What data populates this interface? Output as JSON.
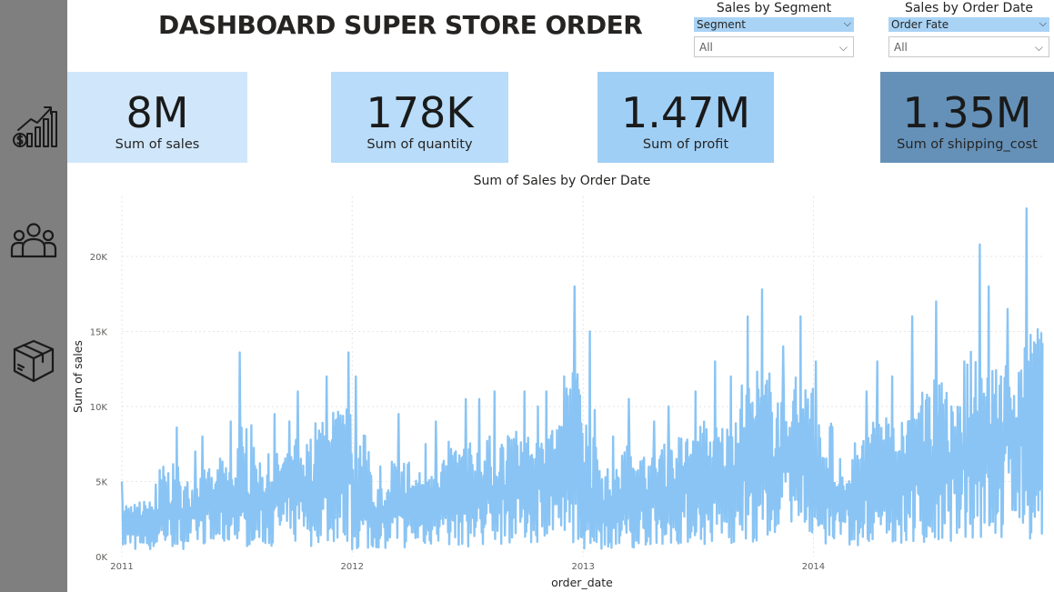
{
  "dashboard": {
    "title": "DASHBOARD SUPER STORE ORDER"
  },
  "sidebar": {
    "items": [
      {
        "icon": "sales-growth-icon"
      },
      {
        "icon": "customers-icon"
      },
      {
        "icon": "product-box-icon"
      }
    ]
  },
  "slicers": [
    {
      "title": "Sales by Segment",
      "field": "Segment",
      "selected": "All"
    },
    {
      "title": "Sales by Order Date",
      "field": "Order Fate",
      "selected": "All"
    }
  ],
  "kpis": [
    {
      "value": "8M",
      "label": "Sum of sales",
      "color": "#d0e7fb"
    },
    {
      "value": "178K",
      "label": "Sum of quantity",
      "color": "#b8dcf9"
    },
    {
      "value": "1.47M",
      "label": "Sum of profit",
      "color": "#a0cff5"
    },
    {
      "value": "1.35M",
      "label": "Sum of shipping_cost",
      "color": "#6591b8"
    }
  ],
  "colors": {
    "sidebar": "#7f7f7f",
    "series": "#89c4f4",
    "slicer_header": "#a9d3f5"
  },
  "chart_data": {
    "type": "line",
    "title": "Sum of Sales by Order Date",
    "xlabel": "order_date",
    "ylabel": "Sum of sales",
    "x_ticks": [
      "2011",
      "2012",
      "2013",
      "2014"
    ],
    "y_ticks": [
      "0K",
      "5K",
      "10K",
      "15K",
      "20K"
    ],
    "xlim": [
      "2011-01-01",
      "2014-12-31"
    ],
    "ylim": [
      0,
      24000
    ],
    "grid": true,
    "series": [
      {
        "x": [
          "2011-01",
          "2011-02",
          "2011-03",
          "2011-04",
          "2011-05",
          "2011-06",
          "2011-07",
          "2011-08",
          "2011-09",
          "2011-10",
          "2011-11",
          "2011-12",
          "2012-01",
          "2012-02",
          "2012-03",
          "2012-04",
          "2012-05",
          "2012-06",
          "2012-07",
          "2012-08",
          "2012-09",
          "2012-10",
          "2012-11",
          "2012-12",
          "2013-01",
          "2013-02",
          "2013-03",
          "2013-04",
          "2013-05",
          "2013-06",
          "2013-07",
          "2013-08",
          "2013-09",
          "2013-10",
          "2013-11",
          "2013-12",
          "2014-01",
          "2014-02",
          "2014-03",
          "2014-04",
          "2014-05",
          "2014-06",
          "2014-07",
          "2014-08",
          "2014-09",
          "2014-10",
          "2014-11",
          "2014-12"
        ],
        "low": [
          300,
          400,
          500,
          500,
          600,
          700,
          600,
          700,
          800,
          700,
          900,
          800,
          400,
          500,
          500,
          600,
          700,
          700,
          600,
          800,
          900,
          900,
          1000,
          900,
          500,
          500,
          600,
          700,
          800,
          800,
          700,
          900,
          1000,
          1000,
          1100,
          1000,
          500,
          600,
          700,
          800,
          900,
          900,
          800,
          1000,
          1100,
          1100,
          1200,
          1100
        ],
        "high": [
          5000,
          4800,
          8600,
          7000,
          8000,
          9000,
          13600,
          9500,
          9000,
          11000,
          12000,
          13600,
          12000,
          6000,
          9500,
          7500,
          9000,
          10500,
          10500,
          11000,
          11000,
          10000,
          11000,
          18000,
          15000,
          8000,
          10500,
          9000,
          10000,
          11000,
          13000,
          12000,
          16000,
          17800,
          14000,
          16000,
          13000,
          6500,
          11000,
          13000,
          12000,
          16000,
          17000,
          13000,
          20800,
          18000,
          16500,
          23200
        ],
        "base": [
          2200,
          2400,
          3200,
          3000,
          3400,
          3600,
          3500,
          3600,
          4400,
          4500,
          5500,
          5600,
          3600,
          3000,
          3400,
          3500,
          4000,
          4200,
          4100,
          4500,
          5500,
          5400,
          6000,
          6200,
          3800,
          3500,
          3800,
          4200,
          4500,
          4800,
          4600,
          5200,
          6400,
          6200,
          7000,
          7200,
          4500,
          3800,
          4400,
          5000,
          5400,
          5800,
          5600,
          6500,
          7800,
          7600,
          8400,
          8600
        ]
      }
    ]
  }
}
